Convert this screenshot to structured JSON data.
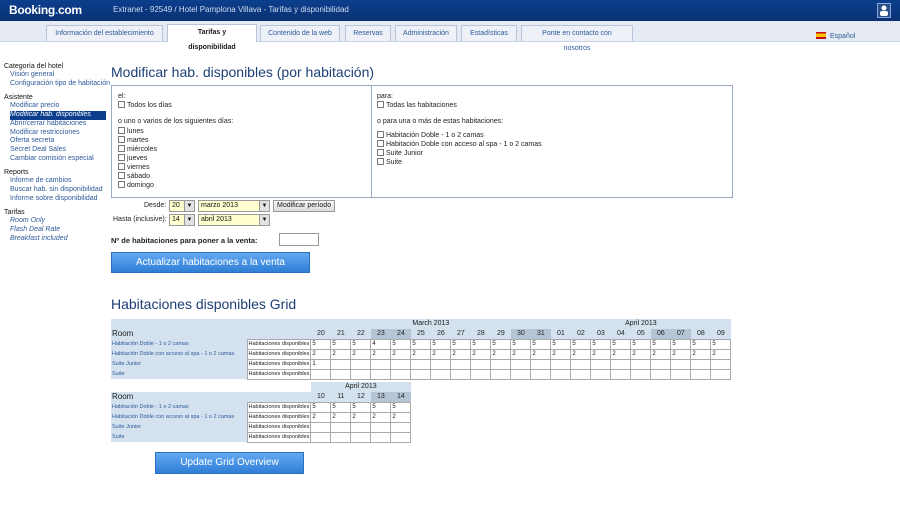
{
  "header": {
    "logo_main": "Booking",
    "logo_dot": ".",
    "logo_suffix": "com",
    "title": "Extranet - 92549 / Hotel Pamplona Villava - Tarifas y disponibilidad"
  },
  "tabs": [
    {
      "label": "Información del establecimiento"
    },
    {
      "label": "Tarifas y disponibilidad"
    },
    {
      "label": "Contenido de la web"
    },
    {
      "label": "Reservas"
    },
    {
      "label": "Administración"
    },
    {
      "label": "Estadísticas"
    },
    {
      "label": "Ponte en contacto con nosotros"
    }
  ],
  "language": "Español",
  "sidebar": {
    "category_head": "Categoría del hotel",
    "category_links": [
      "Visión general",
      "Configuración tipo de habitación"
    ],
    "assistant_head": "Asistente",
    "assistant_links": [
      "Modificar precio",
      "Modificar hab. disponibles",
      "Abrir/cerrar habitaciones",
      "Modificar restricciones",
      "Oferta secreta",
      "Secret Deal Sales",
      "Cambiar comisión especial"
    ],
    "reports_head": "Reports",
    "reports_links": [
      "Informe de cambios",
      "Buscar hab. sin disponibilidad",
      "Informe sobre disponibilidad"
    ],
    "rates_head": "Tarifas",
    "rates_links": [
      "Room Only",
      "Flash Deal Rate",
      "Breakfast included"
    ]
  },
  "main": {
    "title": "Modificar hab. disponibles (por habitación)",
    "left_panel": {
      "el_label": "el:",
      "all_days": "Todos los días",
      "or_days": "o uno o varios de los siguientes días:",
      "days": [
        "lunes",
        "martes",
        "miércoles",
        "jueves",
        "viernes",
        "sábado",
        "domingo"
      ]
    },
    "right_panel": {
      "para_label": "para:",
      "all_rooms": "Todas las habitaciones",
      "or_rooms": "o para una o más de estas habitaciones:",
      "rooms": [
        "Habitación Doble - 1 o 2 camas",
        "Habitación Doble con acceso al spa - 1 o 2 camas",
        "Suite Junior",
        "Suite"
      ]
    },
    "from_label": "Desde:",
    "from_day": "20",
    "from_month": "marzo 2013",
    "modify_period": "Modificar período",
    "to_label": "Hasta (inclusive):",
    "to_day": "14",
    "to_month": "abril 2013",
    "rooms_to_sell_label": "Nº de habitaciones para poner a la venta:",
    "rooms_to_sell_value": "",
    "update_button": "Actualizar habitaciones a la venta"
  },
  "grid": {
    "title": "Habitaciones disponibles Grid",
    "room_header": "Room",
    "rows_label": "Habitaciones disponibles",
    "room_names": [
      "Habitación Doble - 1 o 2 camas",
      "Habitación Doble con acceso al spa - 1 o 2 camas",
      "Suite Junior",
      "Suite"
    ],
    "table1": {
      "month1": "March 2013",
      "month2": "April 2013",
      "days": [
        "20",
        "21",
        "22",
        "23",
        "24",
        "25",
        "26",
        "27",
        "28",
        "29",
        "30",
        "31",
        "01",
        "02",
        "03",
        "04",
        "05",
        "06",
        "07",
        "08",
        "09"
      ],
      "weekend": [
        false,
        false,
        false,
        true,
        true,
        false,
        false,
        false,
        false,
        false,
        true,
        true,
        false,
        false,
        false,
        false,
        false,
        true,
        true,
        false,
        false
      ],
      "rows": [
        [
          "5",
          "5",
          "5",
          "4",
          "5",
          "5",
          "5",
          "5",
          "5",
          "5",
          "5",
          "5",
          "5",
          "5",
          "5",
          "5",
          "5",
          "5",
          "5",
          "5",
          "5"
        ],
        [
          "2",
          "2",
          "2",
          "2",
          "2",
          "2",
          "2",
          "2",
          "2",
          "2",
          "2",
          "2",
          "2",
          "2",
          "2",
          "2",
          "2",
          "2",
          "2",
          "2",
          "2"
        ],
        [
          "1",
          "",
          "",
          "",
          "",
          "",
          "",
          "",
          "",
          "",
          "",
          "",
          "",
          "",
          "",
          "",
          "",
          "",
          "",
          "",
          ""
        ],
        [
          "",
          "",
          "",
          "",
          "",
          "",
          "",
          "",
          "",
          "",
          "",
          "",
          "",
          "",
          "",
          "",
          "",
          "",
          "",
          "",
          ""
        ]
      ]
    },
    "table2": {
      "month": "April 2013",
      "days": [
        "10",
        "11",
        "12",
        "13",
        "14"
      ],
      "weekend": [
        false,
        false,
        false,
        true,
        true
      ],
      "rows": [
        [
          "5",
          "5",
          "5",
          "5",
          "5"
        ],
        [
          "2",
          "2",
          "2",
          "2",
          "2"
        ],
        [
          "",
          "",
          "",
          "",
          ""
        ],
        [
          "",
          "",
          "",
          "",
          ""
        ]
      ]
    },
    "update_button": "Update Grid Overview"
  }
}
